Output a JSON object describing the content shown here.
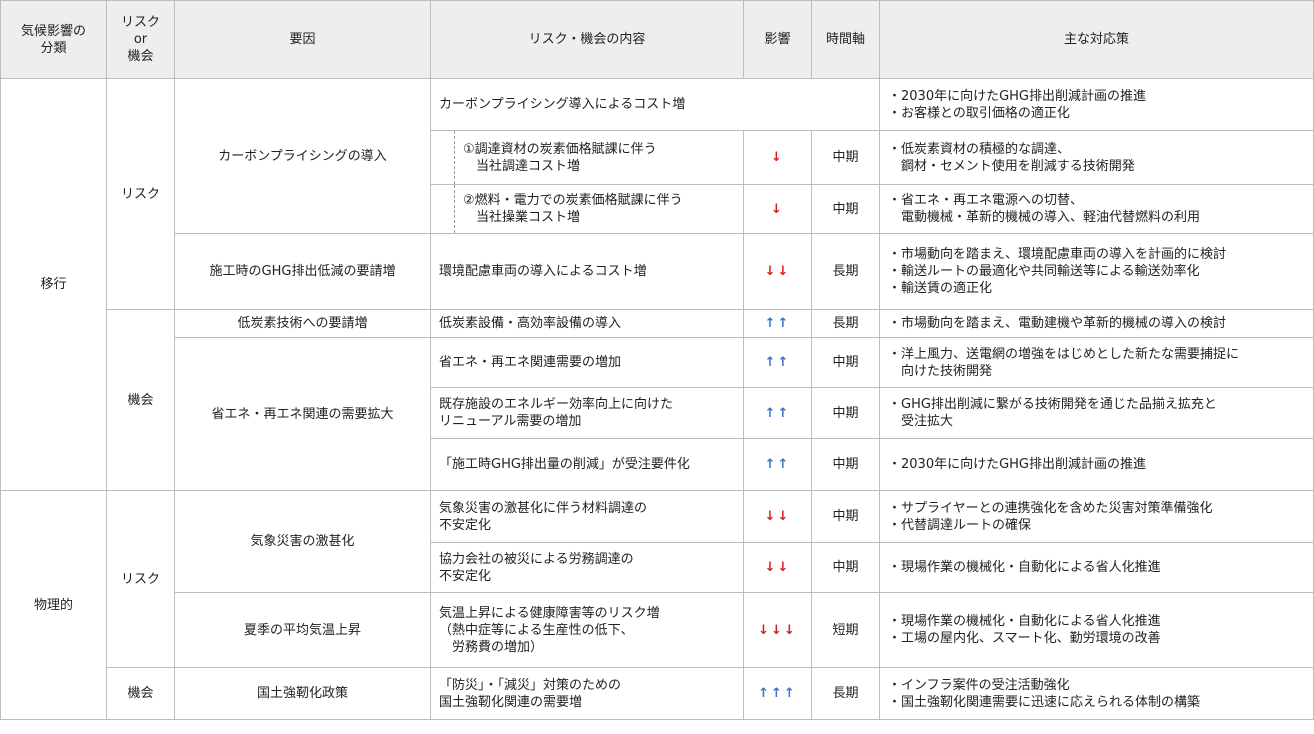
{
  "headers": {
    "category": "気候影響の\n分類",
    "risk_or_opp": "リスク\nor\n機会",
    "factor": "要因",
    "content": "リスク・機会の内容",
    "impact": "影響",
    "timeline": "時間軸",
    "measures": "主な対応策"
  },
  "labels": {
    "transition": "移行",
    "physical": "物理的",
    "risk": "リスク",
    "opportunity": "機会"
  },
  "rows": [
    {
      "factor": "カーボンプライシングの導入",
      "content": "カーボンプライシング導入によるコスト増",
      "measures": "・2030年に向けたGHG排出削減計画の推進\n・お客様との取引価格の適正化"
    },
    {
      "content": "①調達資材の炭素価格賦課に伴う\n　当社調達コスト増",
      "impact": "↓",
      "timeline": "中期",
      "measures": "・低炭素資材の積極的な調達、\n　鋼材・セメント使用を削減する技術開発"
    },
    {
      "content": "②燃料・電力での炭素価格賦課に伴う\n　当社操業コスト増",
      "impact": "↓",
      "timeline": "中期",
      "measures": "・省エネ・再エネ電源への切替、\n　電動機械・革新的機械の導入、軽油代替燃料の利用"
    },
    {
      "factor": "施工時のGHG排出低減の要請増",
      "content": "環境配慮車両の導入によるコスト増",
      "impact": "↓↓",
      "timeline": "長期",
      "measures": "・市場動向を踏まえ、環境配慮車両の導入を計画的に検討\n・輸送ルートの最適化や共同輸送等による輸送効率化\n・輸送賃の適正化"
    },
    {
      "factor": "低炭素技術への要請増",
      "content": "低炭素設備・高効率設備の導入",
      "impact": "↑↑",
      "timeline": "長期",
      "measures": "・市場動向を踏まえ、電動建機や革新的機械の導入の検討"
    },
    {
      "factor": "省エネ・再エネ関連の需要拡大",
      "content": "省エネ・再エネ関連需要の増加",
      "impact": "↑↑",
      "timeline": "中期",
      "measures": "・洋上風力、送電網の増強をはじめとした新たな需要捕捉に\n　向けた技術開発"
    },
    {
      "content": "既存施設のエネルギー効率向上に向けた\nリニューアル需要の増加",
      "impact": "↑↑",
      "timeline": "中期",
      "measures": "・GHG排出削減に繋がる技術開発を通じた品揃え拡充と\n　受注拡大"
    },
    {
      "content": "「施工時GHG排出量の削減」が受注要件化",
      "impact": "↑↑",
      "timeline": "中期",
      "measures": "・2030年に向けたGHG排出削減計画の推進"
    },
    {
      "factor": "気象災害の激甚化",
      "content": "気象災害の激甚化に伴う材料調達の\n不安定化",
      "impact": "↓↓",
      "timeline": "中期",
      "measures": "・サプライヤーとの連携強化を含めた災害対策準備強化\n・代替調達ルートの確保"
    },
    {
      "content": "協力会社の被災による労務調達の\n不安定化",
      "impact": "↓↓",
      "timeline": "中期",
      "measures": "・現場作業の機械化・自動化による省人化推進"
    },
    {
      "factor": "夏季の平均気温上昇",
      "content": "気温上昇による健康障害等のリスク増\n（熱中症等による生産性の低下、\n　労務費の増加）",
      "impact": "↓↓↓",
      "timeline": "短期",
      "measures": "・現場作業の機械化・自動化による省人化推進\n・工場の屋内化、スマート化、勤労環境の改善"
    },
    {
      "factor": "国土強靭化政策",
      "content": "「防災」・「減災」対策のための\n国土強靭化関連の需要増",
      "impact": "↑↑↑",
      "timeline": "長期",
      "measures": "・インフラ案件の受注活動強化\n・国土強靭化関連需要に迅速に応えられる体制の構築"
    }
  ],
  "colors": {
    "down_arrow": "#d0231c",
    "up_arrow": "#3a73c8",
    "header_bg": "#eeeeee",
    "border": "#bdbdbd"
  }
}
